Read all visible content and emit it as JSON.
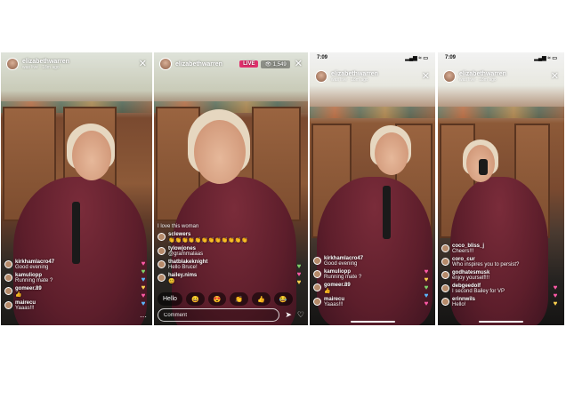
{
  "panels": [
    {
      "username": "elizabethwarren",
      "subtitle": "was live · 18m ago",
      "comments": [
        {
          "user": "kirkhamlacro47",
          "text": "Good evening"
        },
        {
          "user": "kamuliopp",
          "text": "Running mate ?"
        },
        {
          "user": "gomeer.89",
          "text": "👍"
        },
        {
          "user": "mairecu",
          "text": "Yaaas!!!"
        }
      ]
    },
    {
      "username": "elizabethwarren",
      "live_label": "LIVE",
      "viewers": "👁 1,549",
      "comments": [
        {
          "user": "",
          "text": "I love this woman"
        },
        {
          "user": "sclewers",
          "text": "👏👏👏👏👏👏👏👏👏👏👏👏"
        },
        {
          "user": "tylowjones",
          "text": "@grammalaas"
        },
        {
          "user": "thatblakeknight",
          "text": "Hello Bruce!"
        },
        {
          "user": "hailey.nims",
          "text": "😊"
        }
      ],
      "quick_reactions": [
        "Hello",
        "😀",
        "😍",
        "👏",
        "👍",
        "😂"
      ],
      "comment_placeholder": "Comment"
    },
    {
      "status_time": "7:09",
      "status_icons": "▂▄▆ ≈ ▭",
      "username": "elizabethwarren",
      "subtitle": "was live · 18m ago",
      "comments": [
        {
          "user": "kirkhamlacro47",
          "text": "Good evening"
        },
        {
          "user": "kamuliopp",
          "text": "Running mate ?"
        },
        {
          "user": "gomeer.89",
          "text": "👍"
        },
        {
          "user": "mairecu",
          "text": "Yaaas!!!"
        }
      ]
    },
    {
      "status_time": "7:09",
      "status_icons": "▂▄▆ ≈ ▭",
      "username": "elizabethwarren",
      "subtitle": "was live · 18m ago",
      "comments": [
        {
          "user": "coco_bliss_j",
          "text": "Cheers!!!"
        },
        {
          "user": "coro_cur",
          "text": "Who inspires you to persist?"
        },
        {
          "user": "godhatesmusk",
          "text": "enjoy yourself!!!"
        },
        {
          "user": "debgeedolf",
          "text": "I second Bailey for VP"
        },
        {
          "user": "erinnwils",
          "text": "Hello!"
        }
      ]
    }
  ]
}
